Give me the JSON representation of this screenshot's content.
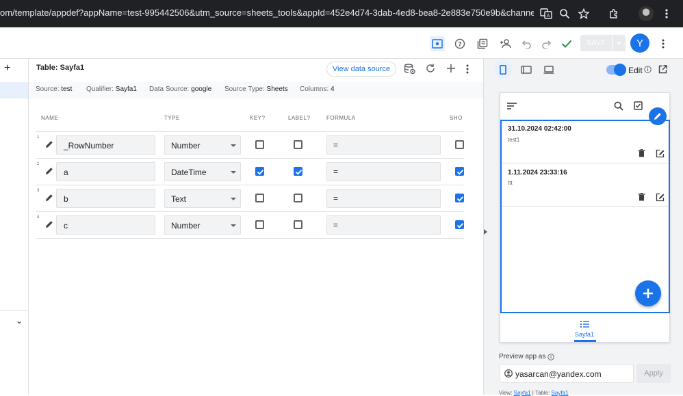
{
  "browser": {
    "url": "om/template/appdef?appName=test-995442506&utm_source=sheets_tools&appId=452e4d74-3dab-4ed8-bea8-2e883e750e9b&channel=she..."
  },
  "toolbar": {
    "save_label": "SAVE",
    "user_initial": "Y"
  },
  "leftrail": {
    "add_symbol": "+",
    "collapse_symbol": "⌄"
  },
  "table": {
    "title": "Table: Sayfa1",
    "view_data_source_label": "View data source",
    "meta": {
      "source_label": "Source:",
      "source_value": "test",
      "qualifier_label": "Qualifier:",
      "qualifier_value": "Sayfa1",
      "datasource_label": "Data Source:",
      "datasource_value": "google",
      "sourcetype_label": "Source Type:",
      "sourcetype_value": "Sheets",
      "columns_label": "Columns:",
      "columns_value": "4"
    },
    "headers": {
      "name": "NAME",
      "type": "TYPE",
      "key": "KEY?",
      "label": "LABEL?",
      "formula": "FORMULA",
      "show": "SHO"
    },
    "rows": [
      {
        "num": "1",
        "name": "_RowNumber",
        "type": "Number",
        "key": false,
        "label": false,
        "formula": "=",
        "show": false
      },
      {
        "num": "2",
        "name": "a",
        "type": "DateTime",
        "key": true,
        "label": true,
        "formula": "=",
        "show": true
      },
      {
        "num": "3",
        "name": "b",
        "type": "Text",
        "key": false,
        "label": false,
        "formula": "=",
        "show": true
      },
      {
        "num": "4",
        "name": "c",
        "type": "Number",
        "key": false,
        "label": false,
        "formula": "=",
        "show": true
      }
    ]
  },
  "preview": {
    "edit_label": "Edit",
    "edit_enabled": true,
    "cards": [
      {
        "title": "31.10.2024 02:42:00",
        "subtitle": "test1"
      },
      {
        "title": "1.11.2024 23:33:16",
        "subtitle": "ttt"
      }
    ],
    "nav_label": "Sayfa1",
    "preview_as_label": "Preview app as",
    "email": "yasarcan@yandex.com",
    "apply_label": "Apply",
    "footer": {
      "view_label": "View:",
      "view_value": "Sayfa1",
      "table_label": "Table:",
      "table_value": "Sayfa1",
      "separator": "|"
    }
  },
  "colors": {
    "accent": "#1a73e8",
    "browser_bar": "#202124",
    "panel_bg": "#f1f3f4"
  }
}
